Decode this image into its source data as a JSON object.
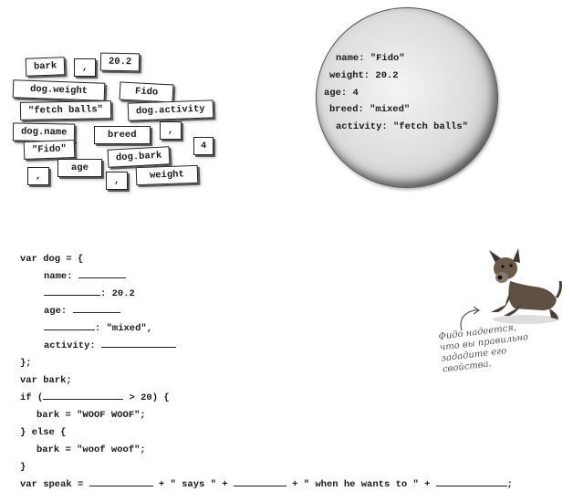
{
  "magnets": [
    {
      "id": "bark",
      "text": "bark"
    },
    {
      "id": "comma1",
      "text": ","
    },
    {
      "id": "num202",
      "text": "20.2"
    },
    {
      "id": "dogweight",
      "text": "dog.weight"
    },
    {
      "id": "fido",
      "text": "Fido"
    },
    {
      "id": "fetchballs",
      "text": "\"fetch balls\""
    },
    {
      "id": "dogactivity",
      "text": "dog.activity"
    },
    {
      "id": "dogname",
      "text": "dog.name"
    },
    {
      "id": "breed",
      "text": "breed"
    },
    {
      "id": "comma2",
      "text": ","
    },
    {
      "id": "fidoquoted",
      "text": "\"Fido\""
    },
    {
      "id": "four",
      "text": "4"
    },
    {
      "id": "dogbark",
      "text": "dog.bark"
    },
    {
      "id": "age",
      "text": "age"
    },
    {
      "id": "comma3",
      "text": ","
    },
    {
      "id": "weight",
      "text": "weight"
    },
    {
      "id": "comma4",
      "text": ","
    }
  ],
  "circle": {
    "lines": [
      "name: \"Fido\"",
      "weight: 20.2",
      "age: 4",
      "breed: \"mixed\"",
      "activity: \"fetch balls\""
    ]
  },
  "code": {
    "l1": "var dog = {",
    "l2": "name: ",
    "l3b": ": 20.2",
    "l4": "age: ",
    "l5b": ": \"mixed\",",
    "l6": "activity: ",
    "l7": "};",
    "l8": "var bark;",
    "l9a": "if (",
    "l9b": " > 20) {",
    "l10": "bark = \"WOOF WOOF\";",
    "l11": "} else {",
    "l12": "bark = \"woof woof\";",
    "l13": "}",
    "l14a": "var speak = ",
    "l14b": " + \" says \" + ",
    "l14c": " + \" when he wants to \" + ",
    "l14d": ";"
  },
  "note": {
    "line1": "Фидо надеется,",
    "line2": "что вы правильно",
    "line3": "зададите его",
    "line4": "свойства."
  },
  "colors": {
    "circle_edge": "#6e6e6e",
    "note_text": "#555555"
  },
  "icons": {
    "dog": "dog-illustration-icon",
    "arrow": "curved-arrow-icon"
  }
}
